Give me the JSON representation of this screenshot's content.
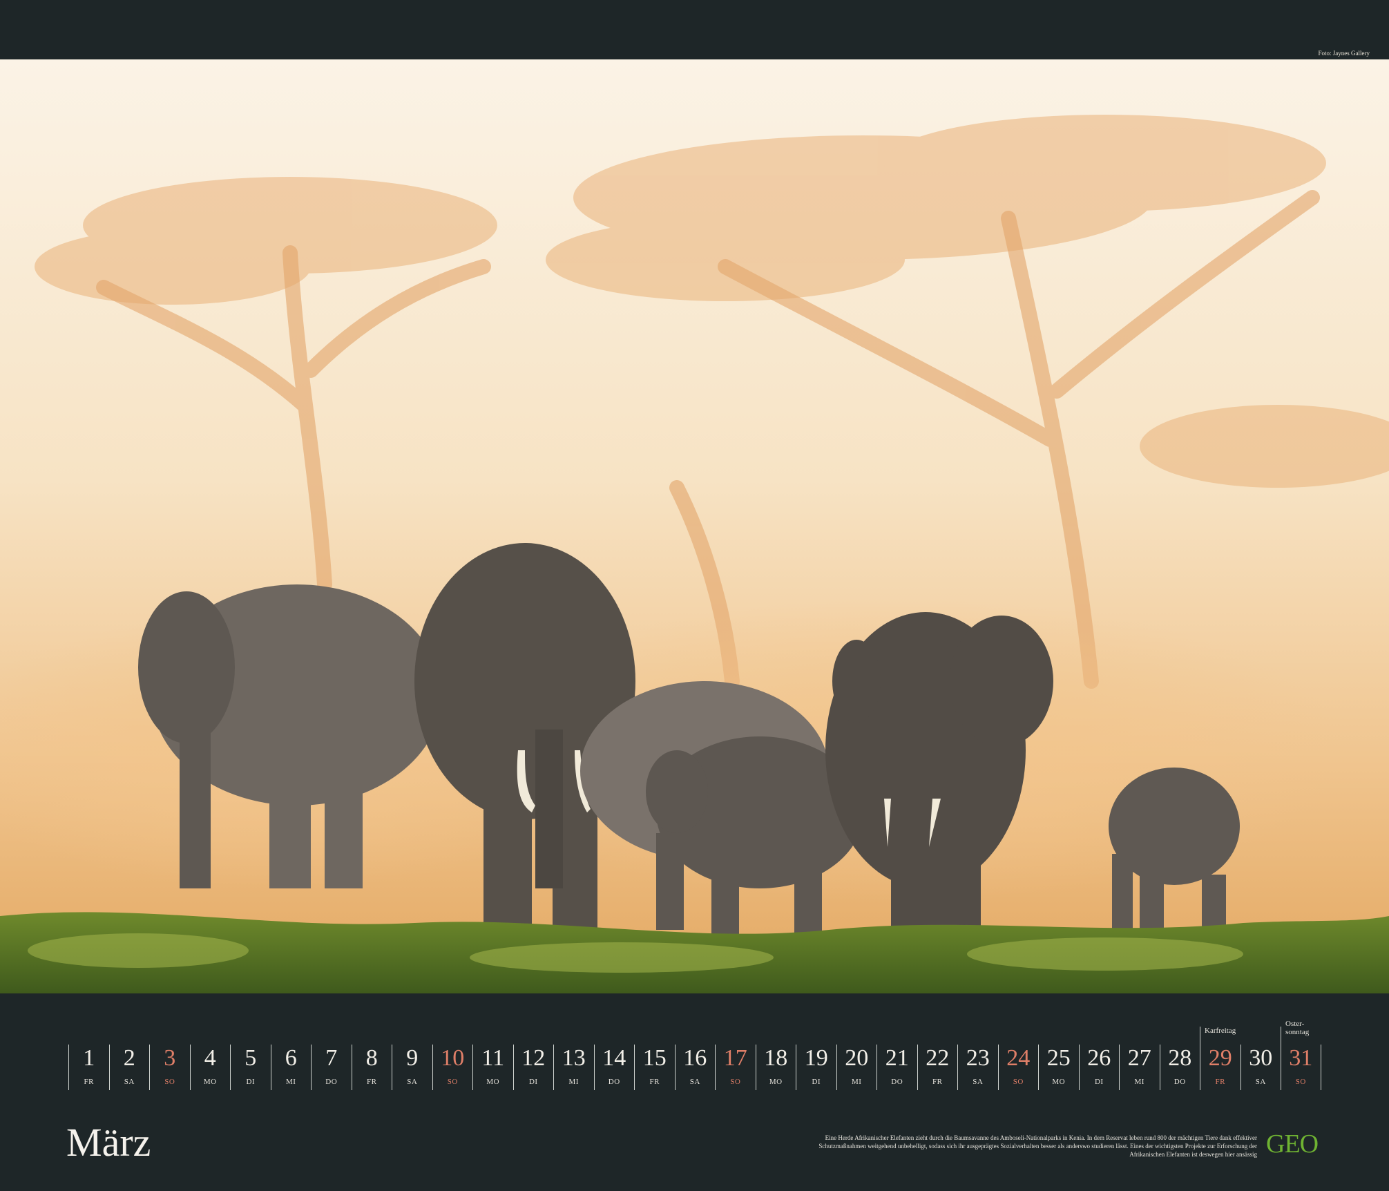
{
  "credit": "Foto: Jaynes Gallery",
  "month": "März",
  "caption": "Eine Herde Afrikanischer Elefanten zieht durch die Baumsavanne des Amboseli-Nationalparks in Kenia. In dem Reservat leben rund 800 der mächtigen Tiere dank effektiver Schutzmaßnahmen weitgehend unbehelligt, sodass sich ihr ausgeprägtes Sozialverhalten besser als anderswo studieren lässt. Eines der wichtigsten Projekte zur Erforschung der Afrikanischen Elefanten ist deswegen hier ansässig",
  "logo": "GEO",
  "colors": {
    "background": "#1e2628",
    "sunday": "#e07f68",
    "logo": "#6fb332"
  },
  "days": [
    {
      "n": "1",
      "wd": "FR"
    },
    {
      "n": "2",
      "wd": "SA"
    },
    {
      "n": "3",
      "wd": "SO",
      "sun": true
    },
    {
      "n": "4",
      "wd": "MO"
    },
    {
      "n": "5",
      "wd": "DI"
    },
    {
      "n": "6",
      "wd": "MI"
    },
    {
      "n": "7",
      "wd": "DO"
    },
    {
      "n": "8",
      "wd": "FR"
    },
    {
      "n": "9",
      "wd": "SA"
    },
    {
      "n": "10",
      "wd": "SO",
      "sun": true
    },
    {
      "n": "11",
      "wd": "MO"
    },
    {
      "n": "12",
      "wd": "DI"
    },
    {
      "n": "13",
      "wd": "MI"
    },
    {
      "n": "14",
      "wd": "DO"
    },
    {
      "n": "15",
      "wd": "FR"
    },
    {
      "n": "16",
      "wd": "SA"
    },
    {
      "n": "17",
      "wd": "SO",
      "sun": true
    },
    {
      "n": "18",
      "wd": "MO"
    },
    {
      "n": "19",
      "wd": "DI"
    },
    {
      "n": "20",
      "wd": "MI"
    },
    {
      "n": "21",
      "wd": "DO"
    },
    {
      "n": "22",
      "wd": "FR"
    },
    {
      "n": "23",
      "wd": "SA"
    },
    {
      "n": "24",
      "wd": "SO",
      "sun": true
    },
    {
      "n": "25",
      "wd": "MO"
    },
    {
      "n": "26",
      "wd": "DI"
    },
    {
      "n": "27",
      "wd": "MI"
    },
    {
      "n": "28",
      "wd": "DO"
    },
    {
      "n": "29",
      "wd": "FR",
      "sun": true,
      "holiday": "Karfreitag"
    },
    {
      "n": "30",
      "wd": "SA"
    },
    {
      "n": "31",
      "wd": "SO",
      "sun": true,
      "holiday": "Oster-\nsonntag"
    }
  ]
}
